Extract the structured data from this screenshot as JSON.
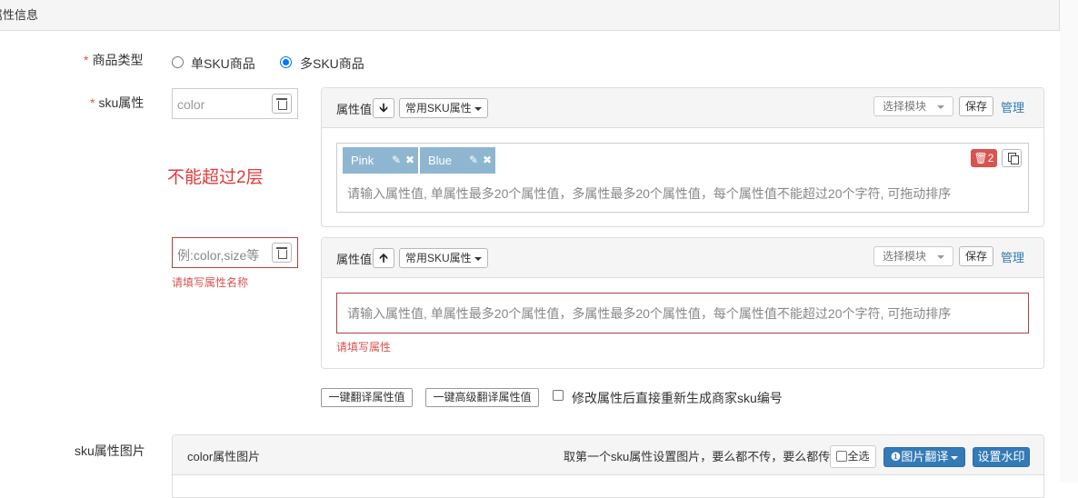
{
  "section": {
    "title": "属性信息"
  },
  "product_type": {
    "label": "商品类型",
    "required_mark": "*",
    "options": [
      {
        "label": "单SKU商品",
        "checked": false
      },
      {
        "label": "多SKU商品",
        "checked": true
      }
    ]
  },
  "sku_attrs": {
    "label": "sku属性",
    "required_mark": "*",
    "limit_warning": "不能超过2层",
    "blocks": [
      {
        "name_value": "color",
        "name_placeholder": "",
        "name_error": "",
        "header_label": "属性值",
        "arrow_icon": "arrow-down-icon",
        "arrow_glyph": "🡫",
        "common_dropdown": "常用SKU属性",
        "select_module": "选择模块",
        "save": "保存",
        "manage": "管理",
        "tags": [
          {
            "label": "Pink"
          },
          {
            "label": "Blue"
          }
        ],
        "badge": "2",
        "values_placeholder": "请输入属性值, 单属性最多20个属性值，多属性最多20个属性值，每个属性值不能超过20个字符, 可拖动排序",
        "values_error": ""
      },
      {
        "name_value": "",
        "name_placeholder": "例:color,size等",
        "name_error": "请填写属性名称",
        "header_label": "属性值",
        "arrow_icon": "arrow-up-icon",
        "arrow_glyph": "🡩",
        "common_dropdown": "常用SKU属性",
        "select_module": "选择模块",
        "save": "保存",
        "manage": "管理",
        "tags": [],
        "values_placeholder": "请输入属性值, 单属性最多20个属性值，多属性最多20个属性值，每个属性值不能超过20个字符, 可拖动排序",
        "values_error": "请填写属性"
      }
    ],
    "actions": {
      "translate": "一键翻译属性值",
      "advanced_translate": "一键高级翻译属性值",
      "regen_checkbox_label": "修改属性后直接重新生成商家sku编号",
      "regen_checked": false
    }
  },
  "sku_images": {
    "label": "sku属性图片",
    "panel_title": "color属性图片",
    "hint": "取第一个sku属性设置图片，要么都不传，要么都传",
    "select_all": "全选",
    "image_translate": "图片翻译",
    "set_watermark": "设置水印"
  },
  "colors": {
    "accent": "#337ab7",
    "danger": "#d9534f",
    "tag": "#8fb6d1",
    "error_border": "#a94442"
  }
}
